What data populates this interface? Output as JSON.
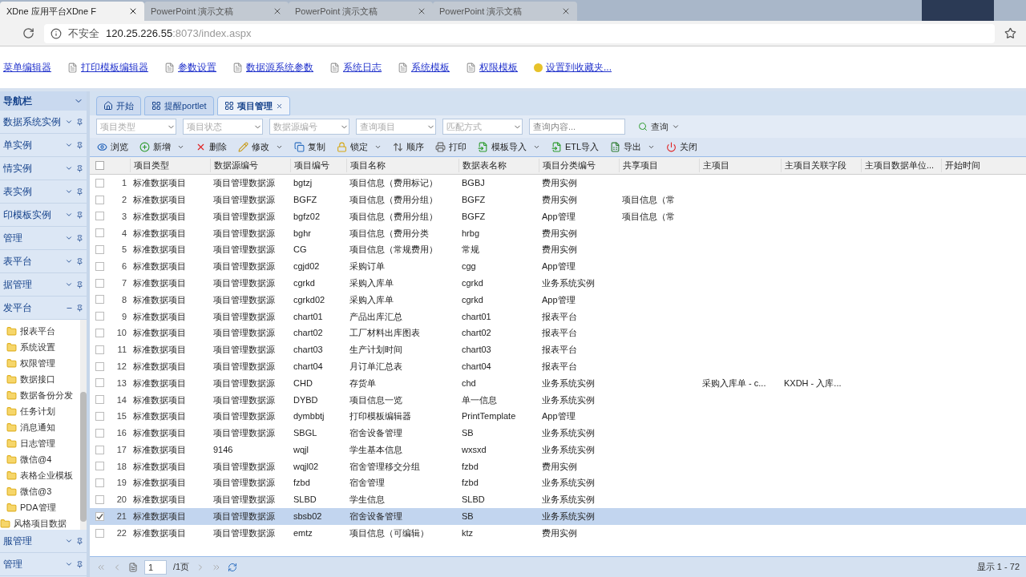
{
  "browser": {
    "tabs": [
      {
        "title": "XDne 应用平台XDne F",
        "selected": true
      },
      {
        "title": "PowerPoint 演示文稿",
        "selected": false
      },
      {
        "title": "PowerPoint 演示文稿",
        "selected": false
      },
      {
        "title": "PowerPoint 演示文稿",
        "selected": false
      }
    ],
    "address": {
      "security": "不安全",
      "host": "120.25.226.55",
      "path": ":8073/index.aspx"
    }
  },
  "links": [
    {
      "label": "菜单编辑器",
      "kind": "plain"
    },
    {
      "label": "打印模板编辑器",
      "kind": "page"
    },
    {
      "label": "参数设置",
      "kind": "page"
    },
    {
      "label": "数据源系统参数",
      "kind": "page"
    },
    {
      "label": "系统日志",
      "kind": "page"
    },
    {
      "label": "系统模板",
      "kind": "page"
    },
    {
      "label": "权限模板",
      "kind": "page"
    },
    {
      "label": "设置到收藏夹...",
      "kind": "favorite"
    }
  ],
  "sidebar": {
    "title": "导航栏",
    "panels": [
      {
        "label": "数据系统实例",
        "expanded": false
      },
      {
        "label": "单实例",
        "expanded": false
      },
      {
        "label": "情实例",
        "expanded": false
      },
      {
        "label": "表实例",
        "expanded": false
      },
      {
        "label": "印模板实例",
        "expanded": false
      },
      {
        "label": "管理",
        "expanded": false
      },
      {
        "label": "表平台",
        "expanded": false
      },
      {
        "label": "据管理",
        "expanded": false
      },
      {
        "label": "发平台",
        "expanded": true,
        "tree": [
          {
            "children": [
              {
                "label": "报表平台"
              },
              {
                "label": "系统设置"
              },
              {
                "label": "权限管理"
              },
              {
                "label": "数据接口"
              },
              {
                "label": "数据备份分发"
              },
              {
                "label": "任务计划"
              },
              {
                "label": "消息通知"
              },
              {
                "label": "日志管理"
              },
              {
                "label": "微信@4"
              },
              {
                "label": "表格企业模板"
              },
              {
                "label": "微信@3"
              },
              {
                "label": "PDA管理"
              }
            ]
          },
          {
            "label": "风格项目数据"
          }
        ]
      },
      {
        "label": "服管理",
        "expanded": false
      },
      {
        "label": "管理",
        "expanded": false
      }
    ]
  },
  "tabs": [
    {
      "label": "开始",
      "selected": false,
      "closable": false
    },
    {
      "label": "提醒portlet",
      "selected": false,
      "closable": false
    },
    {
      "label": "项目管理",
      "selected": true,
      "closable": true
    }
  ],
  "filters": [
    {
      "placeholder": "项目类型"
    },
    {
      "placeholder": "项目状态"
    },
    {
      "placeholder": "数据源编号"
    },
    {
      "placeholder": "查询项目"
    },
    {
      "placeholder": "匹配方式"
    }
  ],
  "search": {
    "placeholder": "查询内容...",
    "button": "查询"
  },
  "toolbar": [
    {
      "label": "浏览",
      "kind": "browse",
      "dropdown": false
    },
    {
      "label": "新增",
      "kind": "add",
      "dropdown": true
    },
    {
      "label": "删除",
      "kind": "delete",
      "dropdown": false
    },
    {
      "label": "修改",
      "kind": "edit",
      "dropdown": true
    },
    {
      "label": "复制",
      "kind": "copy",
      "dropdown": false
    },
    {
      "label": "锁定",
      "kind": "lock",
      "dropdown": true
    },
    {
      "label": "顺序",
      "kind": "order",
      "dropdown": false
    },
    {
      "label": "打印",
      "kind": "print",
      "dropdown": false
    },
    {
      "label": "模板导入",
      "kind": "import",
      "dropdown": true
    },
    {
      "label": "ETL导入",
      "kind": "import",
      "dropdown": false
    },
    {
      "label": "导出",
      "kind": "export",
      "dropdown": true
    },
    {
      "label": "关闭",
      "kind": "close",
      "dropdown": false
    }
  ],
  "table": {
    "all_checked": false,
    "columns": [
      "项目类型",
      "数据源编号",
      "项目编号",
      "项目名称",
      "数据表名称",
      "项目分类编号",
      "共享项目",
      "主项目",
      "主项目关联字段",
      "主项目数据单位...",
      "开始时间"
    ],
    "rows": [
      {
        "number": "1",
        "checked": false,
        "selected": false,
        "cells": [
          "标准数据项目",
          "项目管理数据源",
          "bgtzj",
          "项目信息（费用标记）",
          "BGBJ",
          "费用实例",
          "",
          "",
          "",
          "",
          ""
        ]
      },
      {
        "number": "2",
        "checked": false,
        "selected": false,
        "cells": [
          "标准数据项目",
          "项目管理数据源",
          "BGFZ",
          "项目信息（费用分组）",
          "BGFZ",
          "费用实例",
          "项目信息（常",
          "",
          "",
          "",
          ""
        ]
      },
      {
        "number": "3",
        "checked": false,
        "selected": false,
        "cells": [
          "标准数据项目",
          "项目管理数据源",
          "bgfz02",
          "项目信息（费用分组）",
          "BGFZ",
          "App管理",
          "项目信息（常",
          "",
          "",
          "",
          ""
        ]
      },
      {
        "number": "4",
        "checked": false,
        "selected": false,
        "cells": [
          "标准数据项目",
          "项目管理数据源",
          "bghr",
          "项目信息（费用分类",
          "hrbg",
          "费用实例",
          "",
          "",
          "",
          "",
          ""
        ]
      },
      {
        "number": "5",
        "checked": false,
        "selected": false,
        "cells": [
          "标准数据项目",
          "项目管理数据源",
          "CG",
          "项目信息（常规费用）",
          "常规",
          "费用实例",
          "",
          "",
          "",
          "",
          ""
        ]
      },
      {
        "number": "6",
        "checked": false,
        "selected": false,
        "cells": [
          "标准数据项目",
          "项目管理数据源",
          "cgjd02",
          "采购订单",
          "cgg",
          "App管理",
          "",
          "",
          "",
          "",
          ""
        ]
      },
      {
        "number": "7",
        "checked": false,
        "selected": false,
        "cells": [
          "标准数据项目",
          "项目管理数据源",
          "cgrkd",
          "采购入库单",
          "cgrkd",
          "业务系统实例",
          "",
          "",
          "",
          "",
          ""
        ]
      },
      {
        "number": "8",
        "checked": false,
        "selected": false,
        "cells": [
          "标准数据项目",
          "项目管理数据源",
          "cgrkd02",
          "采购入库单",
          "cgrkd",
          "App管理",
          "",
          "",
          "",
          "",
          ""
        ]
      },
      {
        "number": "9",
        "checked": false,
        "selected": false,
        "cells": [
          "标准数据项目",
          "项目管理数据源",
          "chart01",
          "产品出库汇总",
          "chart01",
          "报表平台",
          "",
          "",
          "",
          "",
          ""
        ]
      },
      {
        "number": "10",
        "checked": false,
        "selected": false,
        "cells": [
          "标准数据项目",
          "项目管理数据源",
          "chart02",
          "工厂材料出库图表",
          "chart02",
          "报表平台",
          "",
          "",
          "",
          "",
          ""
        ]
      },
      {
        "number": "11",
        "checked": false,
        "selected": false,
        "cells": [
          "标准数据项目",
          "项目管理数据源",
          "chart03",
          "生产计划时间",
          "chart03",
          "报表平台",
          "",
          "",
          "",
          "",
          ""
        ]
      },
      {
        "number": "12",
        "checked": false,
        "selected": false,
        "cells": [
          "标准数据项目",
          "项目管理数据源",
          "chart04",
          "月订单汇总表",
          "chart04",
          "报表平台",
          "",
          "",
          "",
          "",
          ""
        ]
      },
      {
        "number": "13",
        "checked": false,
        "selected": false,
        "cells": [
          "标准数据项目",
          "项目管理数据源",
          "CHD",
          "存货单",
          "chd",
          "业务系统实例",
          "",
          "采购入库单 - c...",
          "KXDH - 入库...",
          "",
          ""
        ]
      },
      {
        "number": "14",
        "checked": false,
        "selected": false,
        "cells": [
          "标准数据项目",
          "项目管理数据源",
          "DYBD",
          "项目信息一览",
          "单一信息",
          "业务系统实例",
          "",
          "",
          "",
          "",
          ""
        ]
      },
      {
        "number": "15",
        "checked": false,
        "selected": false,
        "cells": [
          "标准数据项目",
          "项目管理数据源",
          "dymbbtj",
          "打印模板编辑器",
          "PrintTemplate",
          "App管理",
          "",
          "",
          "",
          "",
          ""
        ]
      },
      {
        "number": "16",
        "checked": false,
        "selected": false,
        "cells": [
          "标准数据项目",
          "项目管理数据源",
          "SBGL",
          "宿舍设备管理",
          "SB",
          "业务系统实例",
          "",
          "",
          "",
          "",
          ""
        ]
      },
      {
        "number": "17",
        "checked": false,
        "selected": false,
        "cells": [
          "标准数据项目",
          "9146",
          "wqjl",
          "学生基本信息",
          "wxsxd",
          "业务系统实例",
          "",
          "",
          "",
          "",
          ""
        ]
      },
      {
        "number": "18",
        "checked": false,
        "selected": false,
        "cells": [
          "标准数据项目",
          "项目管理数据源",
          "wqjl02",
          "宿舍管理移交分组",
          "fzbd",
          "费用实例",
          "",
          "",
          "",
          "",
          ""
        ]
      },
      {
        "number": "19",
        "checked": false,
        "selected": false,
        "cells": [
          "标准数据项目",
          "项目管理数据源",
          "fzbd",
          "宿舍管理",
          "fzbd",
          "业务系统实例",
          "",
          "",
          "",
          "",
          ""
        ]
      },
      {
        "number": "20",
        "checked": false,
        "selected": false,
        "cells": [
          "标准数据项目",
          "项目管理数据源",
          "SLBD",
          "学生信息",
          "SLBD",
          "业务系统实例",
          "",
          "",
          "",
          "",
          ""
        ]
      },
      {
        "number": "21",
        "checked": true,
        "selected": true,
        "cells": [
          "标准数据项目",
          "项目管理数据源",
          "sbsb02",
          "宿舍设备管理",
          "SB",
          "业务系统实例",
          "",
          "",
          "",
          "",
          ""
        ]
      },
      {
        "number": "22",
        "checked": false,
        "selected": false,
        "cells": [
          "标准数据项目",
          "项目管理数据源",
          "emtz",
          "项目信息（可编辑）",
          "ktz",
          "费用实例",
          "",
          "",
          "",
          "",
          ""
        ]
      }
    ]
  },
  "pager": {
    "page": "1",
    "total": "/1页",
    "summary": "显示 1 - 72"
  }
}
